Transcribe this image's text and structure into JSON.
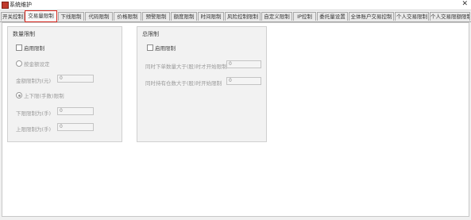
{
  "window": {
    "title": "系统维护",
    "close_glyph": "✕"
  },
  "tabs": [
    {
      "label": "开关控制",
      "active": false
    },
    {
      "label": "交易量限制",
      "active": true
    },
    {
      "label": "下线限制",
      "active": false
    },
    {
      "label": "代码限制",
      "active": false
    },
    {
      "label": "价格限制",
      "active": false
    },
    {
      "label": "预警限制",
      "active": false
    },
    {
      "label": "额度限制",
      "active": false
    },
    {
      "label": "时间限制",
      "active": false
    },
    {
      "label": "风险控制限制",
      "active": false
    },
    {
      "label": "自定义限制",
      "active": false
    },
    {
      "label": "IP控制",
      "active": false
    },
    {
      "label": "委托量设置",
      "active": false
    },
    {
      "label": "全体账户交易控制",
      "active": false
    },
    {
      "label": "个人交易限制",
      "active": false
    },
    {
      "label": "个人交易限额限制",
      "active": false
    }
  ],
  "volume_group": {
    "title": "数量限制",
    "enable_label": "启用限制",
    "radio1_label": "按金额设定",
    "amount_label": "金额限制为(元)",
    "amount_value": "0",
    "radio2_label": "上下限(手数)限制",
    "lower_label": "下限限制为(手)",
    "lower_value": "0",
    "upper_label": "上限限制为(手)",
    "upper_value": "0"
  },
  "position_group": {
    "title": "总限制",
    "enable_label": "启用限制",
    "row1_label": "同时下单数量大于(股)时才开始限制",
    "row1_value": "0",
    "row2_label": "同时持有仓数大于(股)时开始限制",
    "row2_value": "0"
  }
}
